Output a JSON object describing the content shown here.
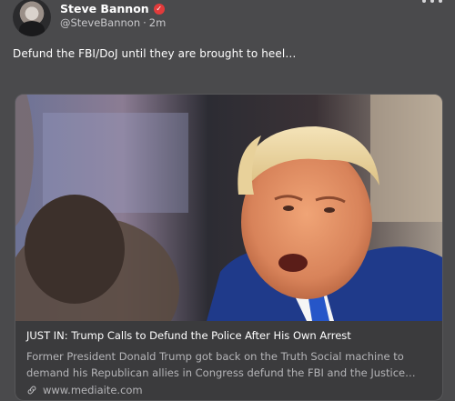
{
  "author": {
    "display_name": "Steve Bannon",
    "verified_icon": "verified-badge-icon",
    "handle": "@SteveBannon",
    "separator": "·",
    "time_ago": "2m"
  },
  "post": {
    "text": "Defund the FBI/DoJ until they are brought to heel…"
  },
  "link_card": {
    "title": "JUST IN: Trump Calls to Defund the Police After His Own Arrest",
    "description_line1": "Former President Donald Trump got back on the Truth Social machine to",
    "description_line2": "demand his Republican allies in Congress defund the FBI and the Justice…",
    "domain": "www.mediaite.com"
  },
  "colors": {
    "background": "#4a4a4c",
    "card_background": "#3b3b3d",
    "verified_badge": "#e23b3b",
    "muted_text": "#b5b5b8"
  }
}
